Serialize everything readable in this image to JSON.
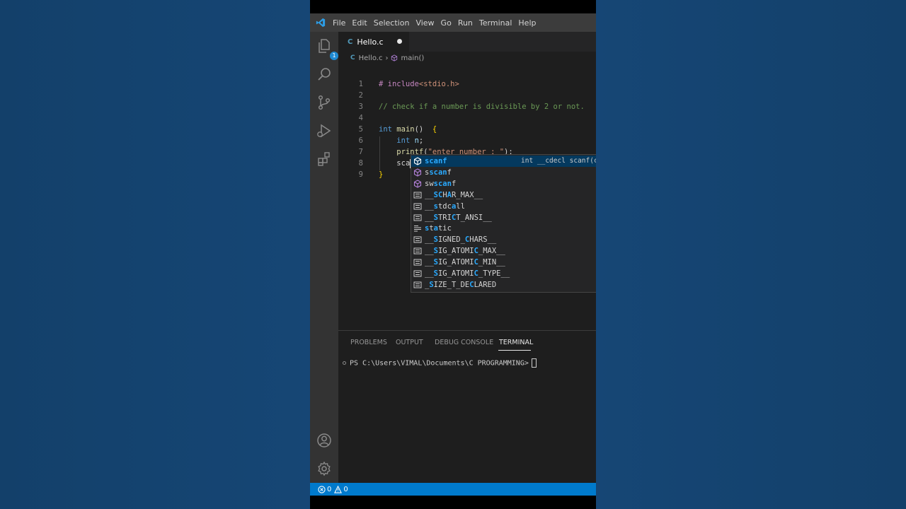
{
  "menu": [
    "File",
    "Edit",
    "Selection",
    "View",
    "Go",
    "Run",
    "Terminal",
    "Help"
  ],
  "activity_badge": "1",
  "tab": {
    "icon_text": "C",
    "label": "Hello.c"
  },
  "breadcrumb": {
    "icon_text": "C",
    "file": "Hello.c",
    "symbol": "main()"
  },
  "code_lines": [
    {
      "n": "1",
      "segments": [
        {
          "t": "# include",
          "c": "#c586c0"
        },
        {
          "t": "<stdio.h>",
          "c": "#ce9178"
        }
      ]
    },
    {
      "n": "2",
      "segments": []
    },
    {
      "n": "3",
      "segments": [
        {
          "t": "// check if a number is divisible by 2 or not.",
          "c": "#6a9955"
        }
      ]
    },
    {
      "n": "4",
      "segments": []
    },
    {
      "n": "5",
      "segments": [
        {
          "t": "int",
          "c": "#569cd6"
        },
        {
          "t": " ",
          "c": "#d4d4d4"
        },
        {
          "t": "main",
          "c": "#dcdcaa"
        },
        {
          "t": "()",
          "c": "#d4d4d4"
        },
        {
          "t": "  {",
          "c": "#ffd700"
        }
      ]
    },
    {
      "n": "6",
      "segments": [
        {
          "t": "    ",
          "c": "#d4d4d4"
        },
        {
          "t": "int",
          "c": "#569cd6"
        },
        {
          "t": " ",
          "c": "#d4d4d4"
        },
        {
          "t": "n",
          "c": "#9cdcfe"
        },
        {
          "t": ";",
          "c": "#d4d4d4"
        }
      ]
    },
    {
      "n": "7",
      "segments": [
        {
          "t": "    ",
          "c": "#d4d4d4"
        },
        {
          "t": "printf",
          "c": "#dcdcaa"
        },
        {
          "t": "(",
          "c": "#d4d4d4"
        },
        {
          "t": "\"enter number : \"",
          "c": "#ce9178"
        },
        {
          "t": ");",
          "c": "#d4d4d4"
        }
      ]
    },
    {
      "n": "8",
      "segments": [
        {
          "t": "    ",
          "c": "#d4d4d4"
        },
        {
          "t": "sca",
          "c": "#d4d4d4"
        }
      ],
      "cursor": true
    },
    {
      "n": "9",
      "segments": [
        {
          "t": "}",
          "c": "#ffd700"
        }
      ]
    }
  ],
  "suggestions": [
    {
      "kind": "function",
      "pre": "",
      "hl": "scanf",
      "post": "",
      "detail": "int __cdecl scanf(co",
      "selected": true
    },
    {
      "kind": "function",
      "pre": "s",
      "hl": "scan",
      "post": "f"
    },
    {
      "kind": "function",
      "pre": "sw",
      "hl": "scan",
      "post": "f"
    },
    {
      "kind": "text",
      "pre": "__",
      "hl": "SC",
      "post": "H",
      "hl2": "A",
      "post2": "R_MAX__"
    },
    {
      "kind": "text",
      "pre": "__",
      "hl": "s",
      "post": "tdc",
      "hl2": "a",
      "post2": "ll"
    },
    {
      "kind": "text",
      "pre": "__",
      "hl": "S",
      "post": "TRI",
      "hl2": "C",
      "post2": "T_ANSI__"
    },
    {
      "kind": "keyword",
      "pre": "",
      "hl": "s",
      "post": "t",
      "hl2": "a",
      "post2": "tic"
    },
    {
      "kind": "text",
      "pre": "__",
      "hl": "S",
      "post": "IGNED_",
      "hl2": "C",
      "post2": "HARS__"
    },
    {
      "kind": "text",
      "pre": "__",
      "hl": "S",
      "post": "IG_ATOMI",
      "hl2": "C",
      "post2": "_MAX__"
    },
    {
      "kind": "text",
      "pre": "__",
      "hl": "S",
      "post": "IG_ATOMI",
      "hl2": "C",
      "post2": "_MIN__"
    },
    {
      "kind": "text",
      "pre": "__",
      "hl": "S",
      "post": "IG_ATOMI",
      "hl2": "C",
      "post2": "_TYPE__"
    },
    {
      "kind": "text",
      "pre": "_",
      "hl": "S",
      "post": "IZE_T_DE",
      "hl2": "C",
      "post2": "LARED"
    }
  ],
  "panel_tabs": [
    "PROBLEMS",
    "OUTPUT",
    "DEBUG CONSOLE",
    "TERMINAL"
  ],
  "active_panel_tab": "TERMINAL",
  "terminal_prompt": "PS C:\\Users\\VIMAL\\Documents\\C PROGRAMMING>",
  "status": {
    "errors": "0",
    "warnings": "0"
  },
  "colors": {
    "accent": "#007acc",
    "selection": "#04395e",
    "match": "#2aaaff"
  }
}
